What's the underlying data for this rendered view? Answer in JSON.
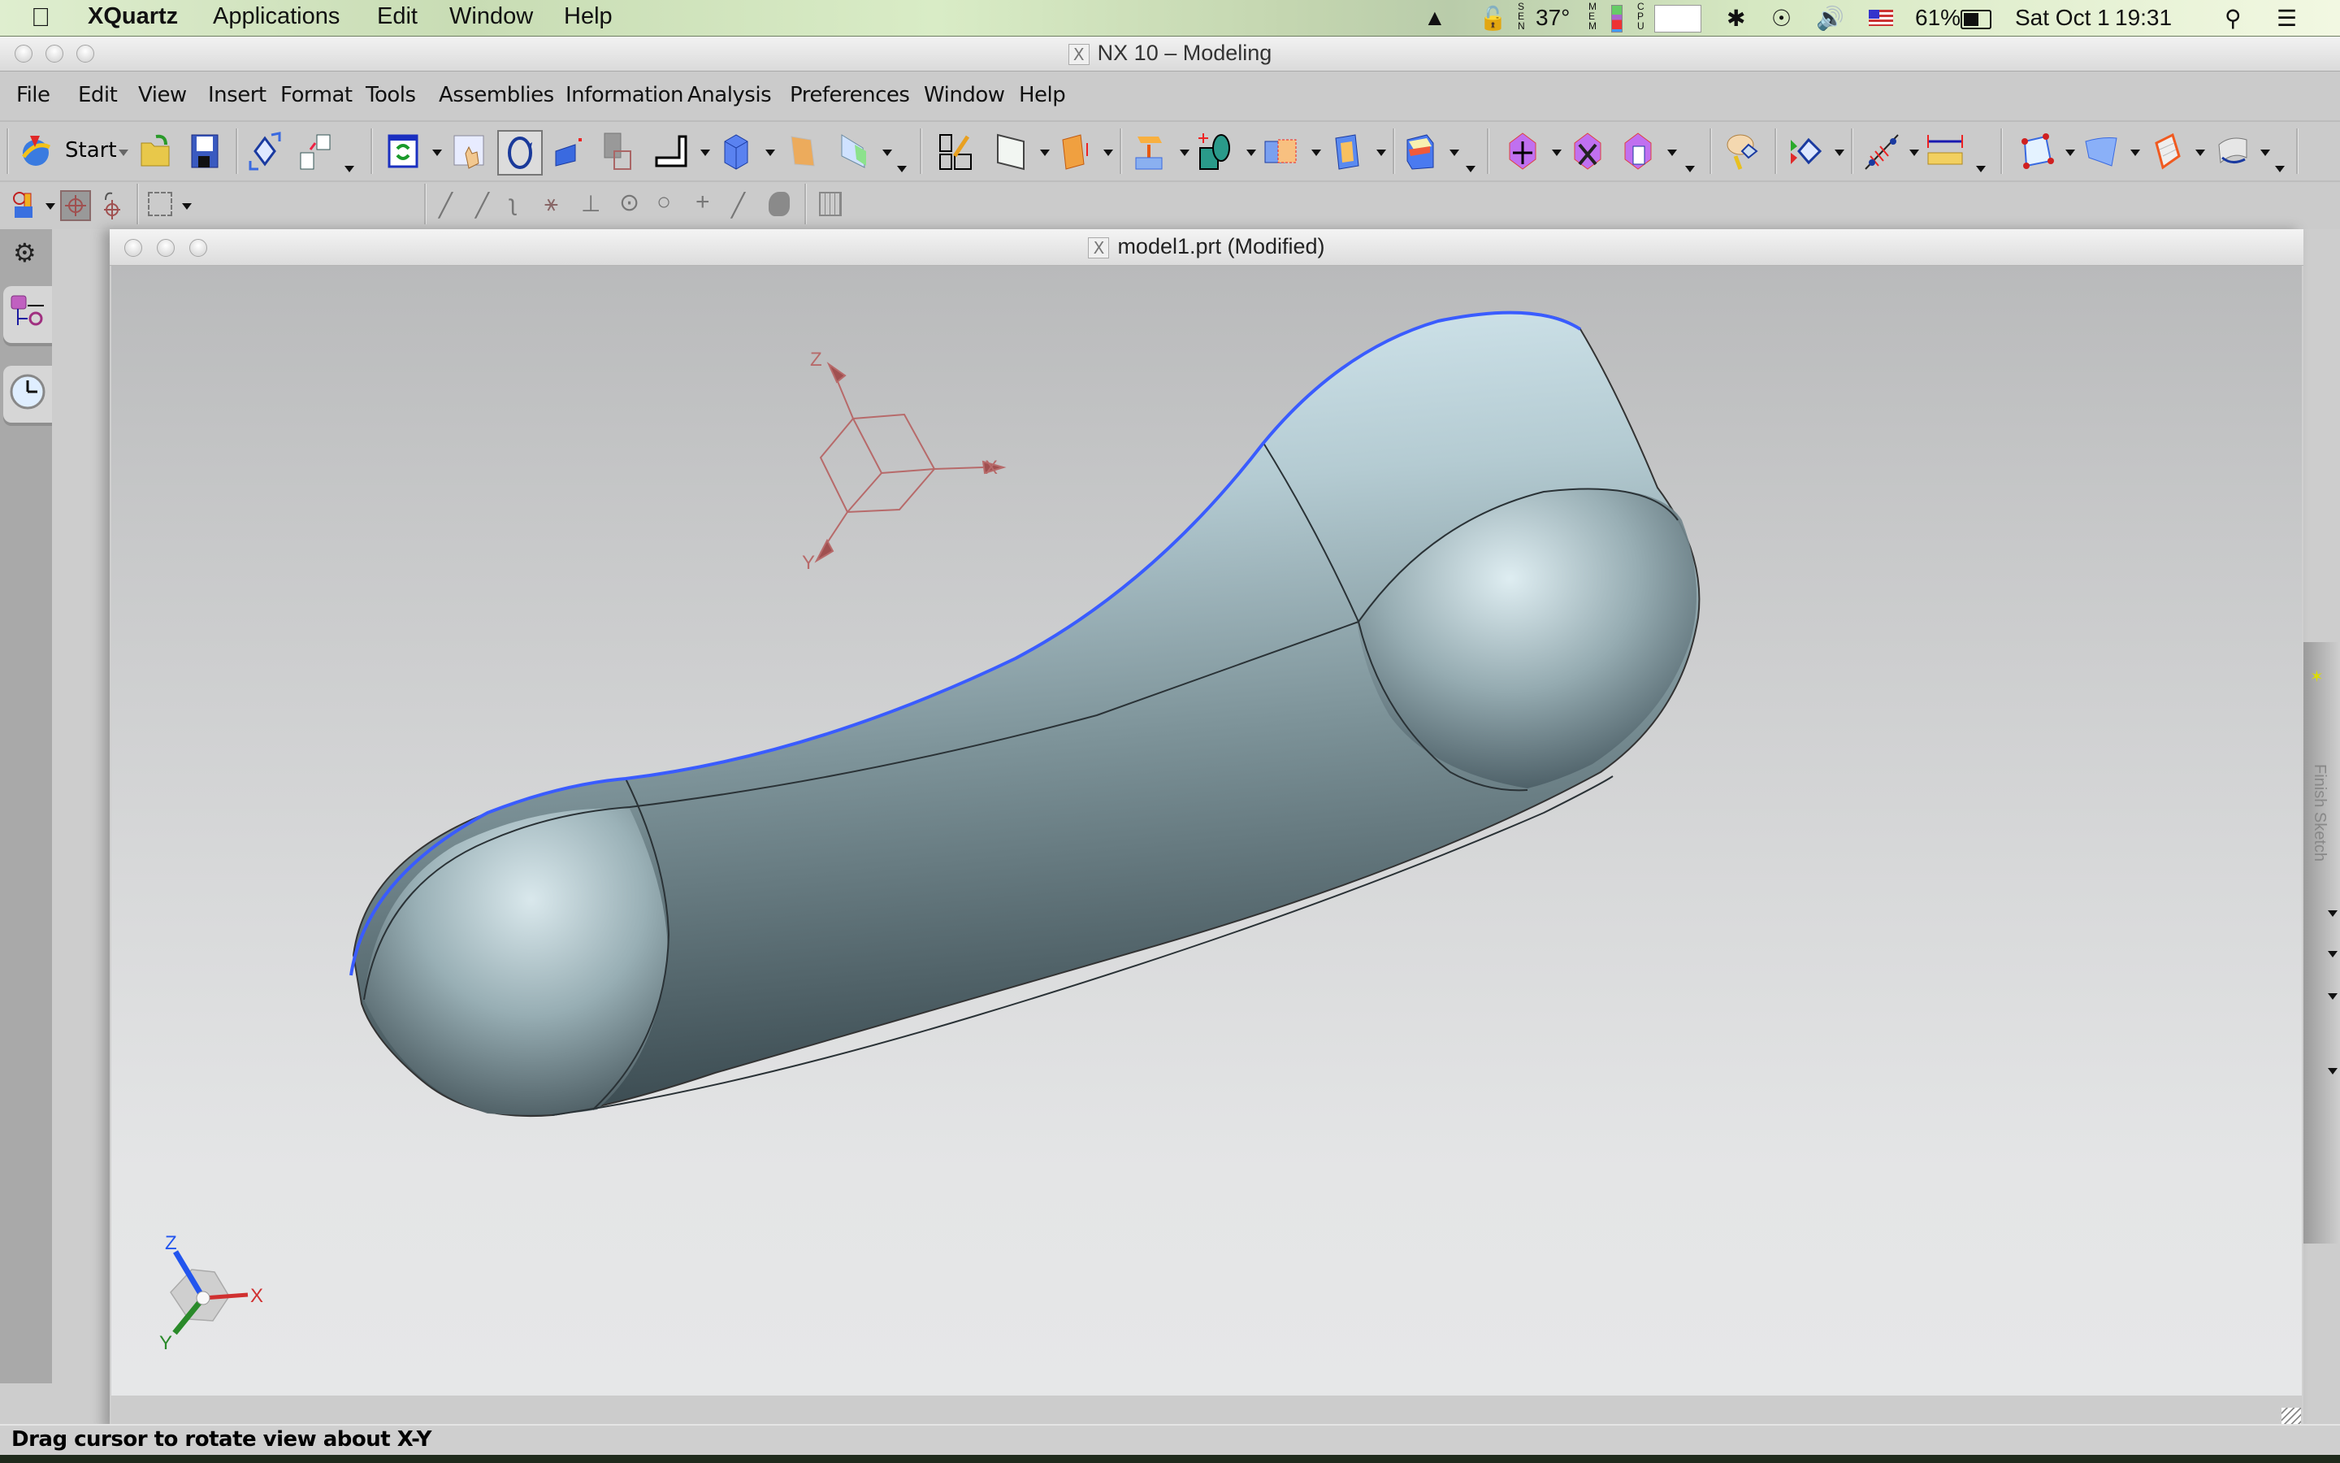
{
  "mac_menubar": {
    "app_name": "XQuartz",
    "menus": [
      "Applications",
      "Edit",
      "Window",
      "Help"
    ],
    "status": {
      "temperature": "37°",
      "sen_label": "SEN",
      "mem_label": "MEM",
      "cpu_label": "CPU",
      "battery": "61%",
      "date": "Sat Oct 1",
      "time": "19:31"
    },
    "tray_icons": [
      "growl-icon",
      "lock-icon",
      "sensor-icon",
      "memory-meter-icon",
      "cpu-meter-icon",
      "bluetooth-icon",
      "wifi-icon",
      "volume-icon",
      "us-flag-input-icon",
      "battery-icon",
      "spotlight-search-icon",
      "notification-center-icon"
    ]
  },
  "main_window": {
    "title": "NX 10 – Modeling",
    "menus": [
      "File",
      "Edit",
      "View",
      "Insert",
      "Format",
      "Tools",
      "Assemblies",
      "Information",
      "Analysis",
      "Preferences",
      "Window",
      "Help"
    ],
    "toolbar": {
      "start_label": "Start",
      "groups": [
        [
          "start-icon",
          "open-icon",
          "save-icon"
        ],
        [
          "wave-link-icon",
          "assembly-structure-icon"
        ],
        [
          "refresh-icon",
          "pan-icon",
          "rotate-icon",
          "zoom-icon",
          "layer-icon",
          "sketch-line-icon",
          "cube-view-icon",
          "edge-display-icon",
          "face-display-icon"
        ],
        [
          "sketch-icon",
          "datum-plane-icon",
          "extrude-icon"
        ],
        [
          "move-face-icon",
          "boolean-icon",
          "offset-icon",
          "shell-icon"
        ],
        [
          "edge-blend-icon"
        ],
        [
          "move-object-icon",
          "delete-object-icon",
          "copy-object-icon"
        ],
        [
          "edit-object-display-icon"
        ],
        [
          "show-hide-icon"
        ],
        [
          "analysis-icon",
          "measure-distance-icon"
        ],
        [
          "four-point-surface-icon",
          "studio-surface-icon",
          "x-form-icon",
          "sweep-icon"
        ]
      ]
    },
    "selection_bar": {
      "filter_value": "Inside",
      "snap_icons": [
        "end-point-icon",
        "mid-point-icon",
        "control-point-icon",
        "intersection-icon",
        "arc-center-icon",
        "quadrant-icon",
        "existing-point-icon",
        "point-on-curve-icon",
        "point-on-surface-icon",
        "face-icon",
        "grid-icon"
      ]
    },
    "resource_bar": [
      "roles-gear-icon",
      "part-navigator-icon",
      "history-clock-icon"
    ],
    "status_message": "Drag cursor to rotate view about X-Y"
  },
  "graphics_window": {
    "title": "model1.prt (Modified)",
    "datum_csys_labels": {
      "x": "X",
      "y": "Y",
      "z": "Z"
    },
    "view_triad_labels": {
      "x": "X",
      "y": "Y",
      "z": "Z"
    },
    "colors": {
      "selected_edge": "#3a5cff",
      "csys": "#b76a6a",
      "triad_x": "#d03030",
      "triad_y": "#2a8a2a",
      "triad_z": "#2255ee"
    }
  },
  "right_dock": {
    "label": "Finish Sketch"
  }
}
